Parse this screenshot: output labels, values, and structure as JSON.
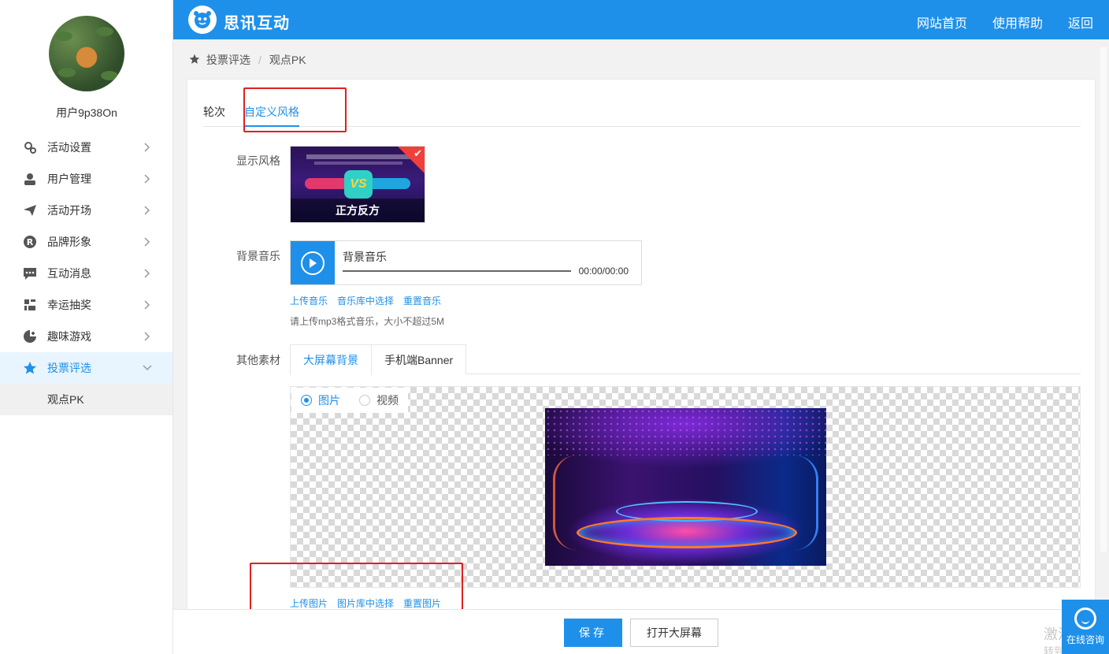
{
  "sidebar": {
    "username": "用户9p38On",
    "items": [
      {
        "label": "活动设置",
        "icon": "gear-icon"
      },
      {
        "label": "用户管理",
        "icon": "user-icon"
      },
      {
        "label": "活动开场",
        "icon": "send-icon"
      },
      {
        "label": "品牌形象",
        "icon": "registered-icon"
      },
      {
        "label": "互动消息",
        "icon": "message-icon"
      },
      {
        "label": "幸运抽奖",
        "icon": "gift-icon"
      },
      {
        "label": "趣味游戏",
        "icon": "game-icon"
      },
      {
        "label": "投票评选",
        "icon": "star-icon",
        "active": true
      }
    ],
    "sub_item": "观点PK"
  },
  "header": {
    "brand": "思讯互动",
    "nav": [
      "网站首页",
      "使用帮助",
      "返回"
    ]
  },
  "breadcrumb": {
    "root": "投票评选",
    "separator": "/",
    "current": "观点PK"
  },
  "tabs": [
    "轮次",
    "自定义风格"
  ],
  "form": {
    "style_label": "显示风格",
    "style_caption": "正方反方",
    "style_vs": "VS",
    "music_label": "背景音乐",
    "music_title": "背景音乐",
    "music_time": "00:00/00:00",
    "music_links": [
      "上传音乐",
      "音乐库中选择",
      "重置音乐"
    ],
    "music_hint": "请上传mp3格式音乐，大小不超过5M",
    "other_label": "其他素材",
    "sub_tabs": [
      "大屏幕背景",
      "手机端Banner"
    ],
    "radio_image": "图片",
    "radio_video": "视频",
    "image_links": [
      "上传图片",
      "图片库中选择",
      "重置图片"
    ]
  },
  "footer": {
    "save": "保存",
    "open_screen": "打开大屏幕",
    "watermark": "激活 Win",
    "watermark2": "转到\"设置\""
  },
  "consult": "在线咨询",
  "colors": {
    "primary": "#1e90ea",
    "highlight_box": "#e02020"
  }
}
